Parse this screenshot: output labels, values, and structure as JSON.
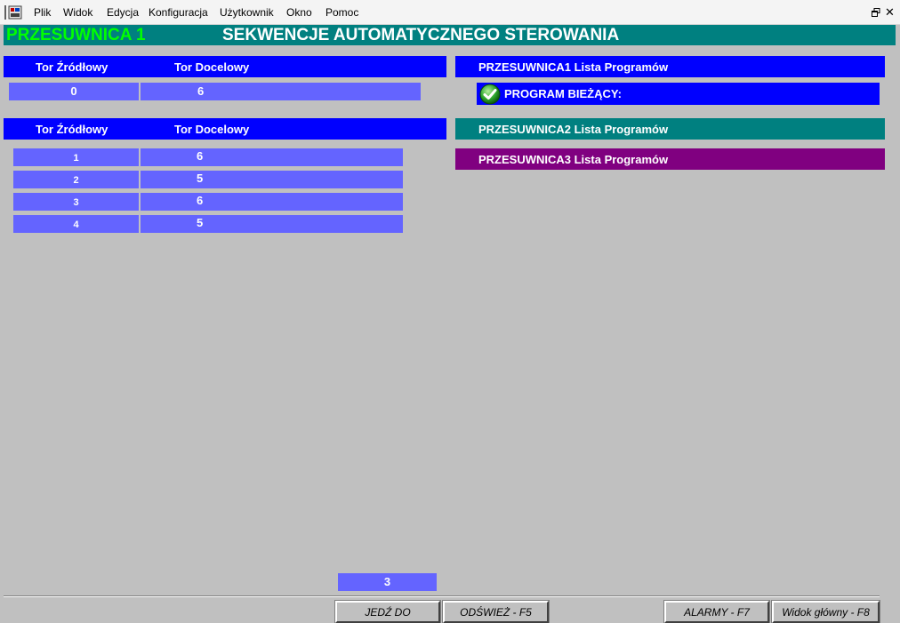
{
  "menu": {
    "items": [
      "Plik",
      "Widok",
      "Edycja",
      "Konfiguracja",
      "Użytkownik",
      "Okno",
      "Pomoc"
    ]
  },
  "window": {
    "close_glyph": "✕"
  },
  "title": {
    "left": "PRZESUWNICA 1",
    "center": "SEKWENCJE AUTOMATYCZNEGO STEROWANIA"
  },
  "current": {
    "header_source": "Tor Źródłowy",
    "header_target": "Tor Docelowy",
    "source": "0",
    "target": "6"
  },
  "sequence": {
    "header_source": "Tor Źródłowy",
    "header_target": "Tor Docelowy",
    "rows": [
      {
        "n": "1",
        "target": "6"
      },
      {
        "n": "2",
        "target": "5"
      },
      {
        "n": "3",
        "target": "6"
      },
      {
        "n": "4",
        "target": "5"
      }
    ]
  },
  "programs": {
    "p1": "PRZESUWNICA1  Lista Programów",
    "current_label": "PROGRAM BIEŻĄCY:",
    "p2": "PRZESUWNICA2  Lista Programów",
    "p3": "PRZESUWNICA3  Lista Programów",
    "p1_color": "#0000ff",
    "p2_color": "#008080",
    "p3_color": "#800080"
  },
  "counter": "3",
  "buttons": {
    "jedz": "JEDŹ DO",
    "odswiez": "ODŚWIEŻ - F5",
    "alarmy": "ALARMY - F7",
    "widok": "Widok główny - F8"
  }
}
